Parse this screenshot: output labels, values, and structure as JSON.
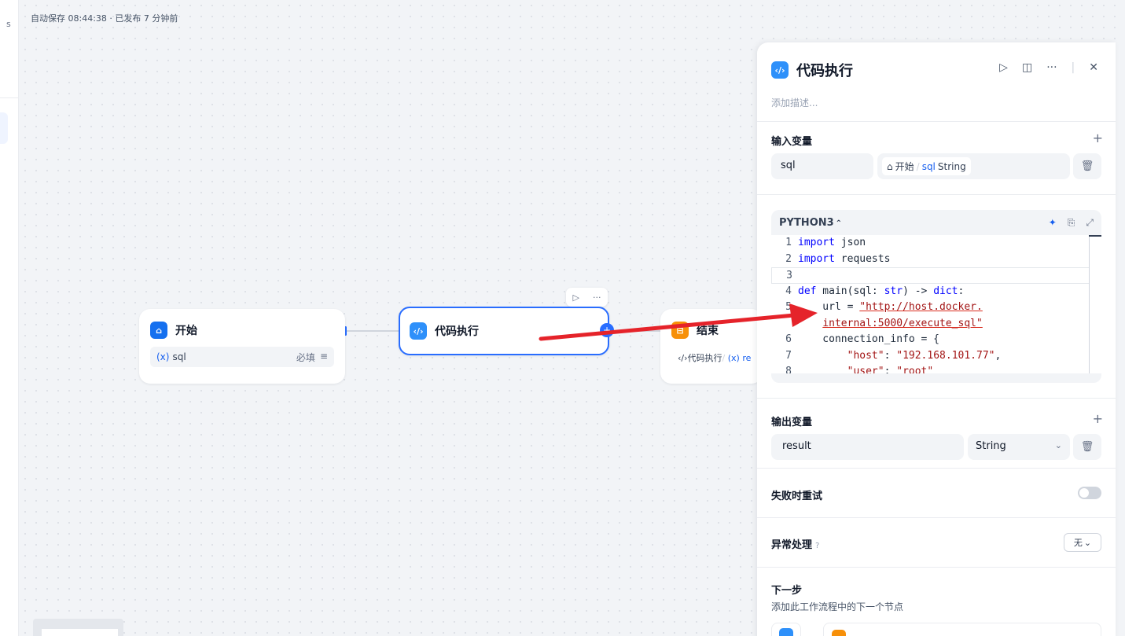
{
  "autosave": "自动保存 08:44:38 · 已发布 7 分钟前",
  "left_rail": {
    "mark": "s"
  },
  "nodes": {
    "start": {
      "title": "开始",
      "var_icon": "(x)",
      "var_name": "sql",
      "required": "必填",
      "menu_icon": "≡"
    },
    "code": {
      "title": "代码执行",
      "toolbar_run": "▷",
      "toolbar_more": "···",
      "handle": "+"
    },
    "end": {
      "title": "结束",
      "ref_prefix": "代码执行",
      "ref_sep": "/",
      "ref_var": "(x) re"
    }
  },
  "panel": {
    "title": "代码执行",
    "description_placeholder": "添加描述...",
    "actions": {
      "run": "▷",
      "split": "◫",
      "more": "···",
      "close": "✕"
    },
    "input_section": {
      "title": "输入变量",
      "add": "+",
      "var_name": "sql",
      "ref_node": "开始",
      "ref_sep": "/",
      "ref_var": "sql",
      "ref_type": "String"
    },
    "code": {
      "language": "PYTHON3",
      "lang_switch": "⌃",
      "lines": [
        {
          "n": "1",
          "segments": [
            {
              "t": "import",
              "c": "kw"
            },
            {
              "t": " json",
              "c": ""
            }
          ]
        },
        {
          "n": "2",
          "segments": [
            {
              "t": "import",
              "c": "kw"
            },
            {
              "t": " requests",
              "c": ""
            }
          ]
        },
        {
          "n": "3",
          "segments": [
            {
              "t": "",
              "c": ""
            }
          ],
          "active": true
        },
        {
          "n": "4",
          "segments": [
            {
              "t": "def",
              "c": "kw"
            },
            {
              "t": " main(sql: ",
              "c": ""
            },
            {
              "t": "str",
              "c": "kw"
            },
            {
              "t": ") -> ",
              "c": ""
            },
            {
              "t": "dict",
              "c": "kw"
            },
            {
              "t": ":",
              "c": ""
            }
          ]
        },
        {
          "n": "5",
          "segments": [
            {
              "t": "    url = ",
              "c": ""
            },
            {
              "t": "\"http://host.docker.",
              "c": "str"
            }
          ]
        },
        {
          "n": "",
          "segments": [
            {
              "t": "    ",
              "c": ""
            },
            {
              "t": "internal:5000/execute_sql\"",
              "c": "str"
            }
          ]
        },
        {
          "n": "6",
          "segments": [
            {
              "t": "    connection_info = {",
              "c": ""
            }
          ]
        },
        {
          "n": "7",
          "segments": [
            {
              "t": "        ",
              "c": ""
            },
            {
              "t": "\"host\"",
              "c": "str2"
            },
            {
              "t": ": ",
              "c": ""
            },
            {
              "t": "\"192.168.101.77\"",
              "c": "str2"
            },
            {
              "t": ",",
              "c": ""
            }
          ]
        },
        {
          "n": "8",
          "segments": [
            {
              "t": "        ",
              "c": ""
            },
            {
              "t": "\"user\"",
              "c": "str2"
            },
            {
              "t": ": ",
              "c": ""
            },
            {
              "t": "\"root\"",
              "c": "str2"
            }
          ]
        }
      ]
    },
    "output_section": {
      "title": "输出变量",
      "add": "+",
      "var_name": "result",
      "var_type": "String",
      "chevron": "⌄"
    },
    "retry_section": {
      "title": "失败时重试",
      "enabled": false
    },
    "error_section": {
      "title": "异常处理",
      "help": "?",
      "value": "无",
      "chevron": "⌄"
    },
    "next_section": {
      "title": "下一步",
      "description": "添加此工作流程中的下一个节点"
    }
  },
  "colors": {
    "accent": "#296dff",
    "code_icon": "#2e90fa",
    "end_icon": "#f79009",
    "start_icon": "#1570ef",
    "arrow": "#e5232a"
  }
}
